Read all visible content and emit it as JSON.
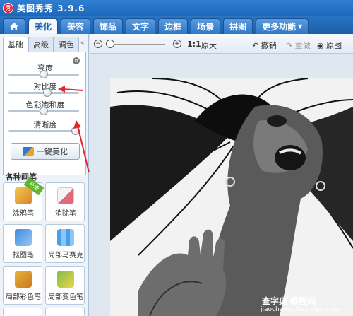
{
  "app": {
    "title": "美图秀秀 3.9.6",
    "logo_text": "秀"
  },
  "tabs": {
    "home_icon": "home-icon",
    "items": [
      "美化",
      "美容",
      "饰品",
      "文字",
      "边框",
      "场景",
      "拼图",
      "更多功能"
    ],
    "active": "美化"
  },
  "left_panel": {
    "subtabs": [
      "基础",
      "高级",
      "调色"
    ],
    "active_subtab": "基础",
    "sliders": [
      {
        "label": "亮度",
        "value": 0.5
      },
      {
        "label": "对比度",
        "value": 0.55
      },
      {
        "label": "色彩饱和度",
        "value": 0.5
      },
      {
        "label": "清晰度",
        "value": 0.95
      }
    ],
    "one_click_label": "一键美化",
    "brush_section_title": "各种画笔",
    "brushes": [
      {
        "label": "涂鸦笔",
        "badge": "升级"
      },
      {
        "label": "消除笔",
        "badge": ""
      },
      {
        "label": "抠图笔",
        "badge": ""
      },
      {
        "label": "局部马赛克",
        "badge": ""
      },
      {
        "label": "局部彩色笔",
        "badge": ""
      },
      {
        "label": "局部变色笔",
        "badge": ""
      }
    ]
  },
  "toolbar": {
    "zoom_minus": "−",
    "zoom_plus": "+",
    "zoom_level": 0.05,
    "ratio_label": "1:1",
    "original_size_label": "原大",
    "undo_label": "撤销",
    "redo_label": "重做",
    "original_image_label": "原图"
  },
  "watermark": {
    "line1": "查字典 教程网",
    "line2": "jiaocheng.chazidian.com"
  },
  "colors": {
    "accent": "#1d68bd",
    "annotation_arrow": "#e0262e"
  }
}
